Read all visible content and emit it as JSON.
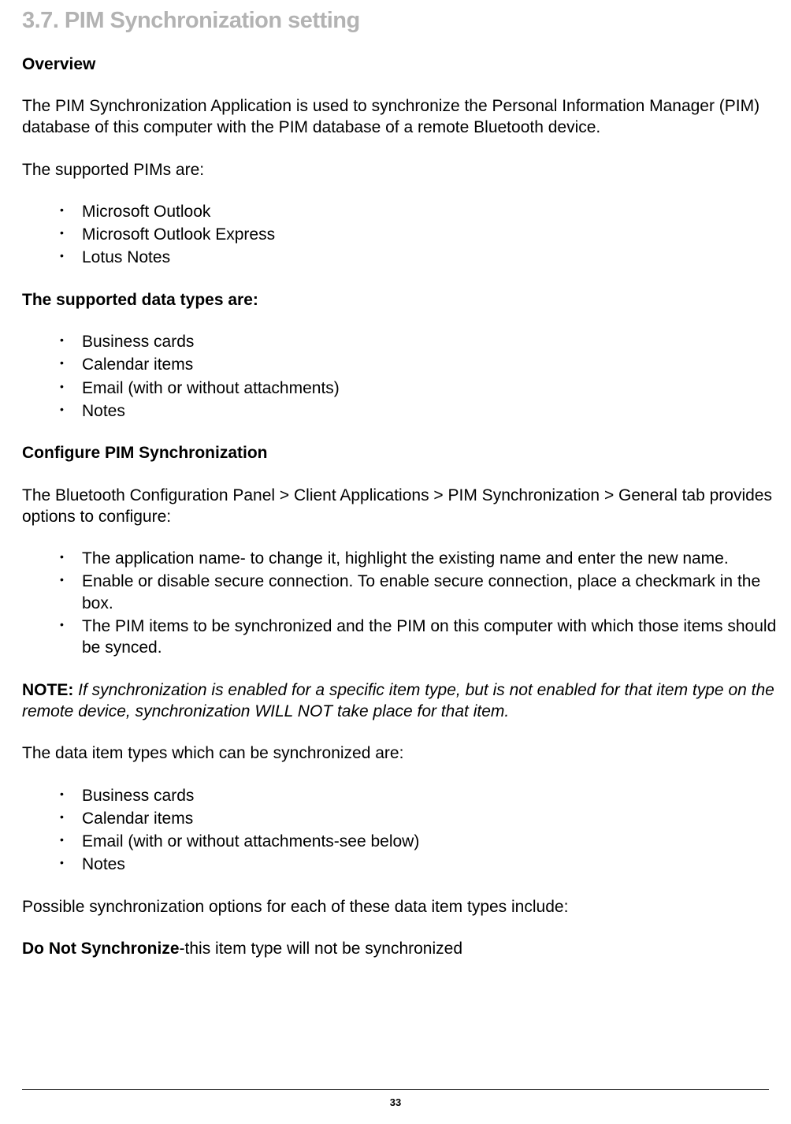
{
  "sectionTitle": "3.7. PIM Synchronization setting",
  "overview": {
    "heading": "Overview",
    "para1": "The PIM Synchronization Application is used to synchronize the Personal Information Manager (PIM) database of this computer with the PIM database of a remote Bluetooth device.",
    "para2": "The supported PIMs are:",
    "pimList": [
      "Microsoft Outlook",
      "Microsoft Outlook Express",
      "Lotus Notes"
    ]
  },
  "dataTypes": {
    "heading": "The supported data types are:",
    "list": [
      "Business cards",
      "Calendar items",
      "Email (with or without attachments)",
      "Notes"
    ]
  },
  "configure": {
    "heading": "Configure PIM Synchronization",
    "para1": "The Bluetooth Configuration Panel > Client Applications > PIM Synchronization > General tab provides options to configure:",
    "list": [
      "The application name- to change it, highlight the existing name and enter the new name.",
      "Enable or disable secure connection. To enable secure connection, place a checkmark in the box.",
      "The PIM items to be synchronized and the PIM on this computer with which those items should be synced."
    ]
  },
  "note": {
    "label": "NOTE:",
    "text": " If synchronization is enabled for a specific item type, but is not enabled for that item type on the remote device, synchronization WILL NOT take place for that item."
  },
  "syncItems": {
    "para": "The data item types which can be synchronized are:",
    "list": [
      "Business cards",
      "Calendar items",
      "Email (with or without attachments-see below)",
      "Notes"
    ]
  },
  "options": {
    "para": "Possible synchronization options for each of these data item types include:",
    "label": "Do Not Synchronize",
    "text": "-this item type will not be synchronized"
  },
  "pageNumber": "33"
}
